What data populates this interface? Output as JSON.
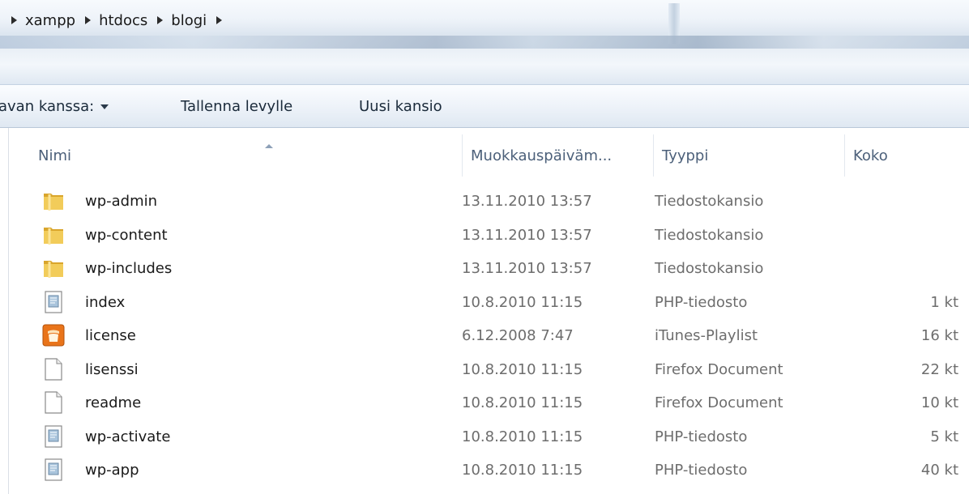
{
  "address": {
    "crumbs": [
      {
        "label": "xampp"
      },
      {
        "label": "htdocs"
      },
      {
        "label": "blogi"
      }
    ]
  },
  "commands": {
    "share_label": "avan kanssa:",
    "save_label": "Tallenna levylle",
    "newfolder_label": "Uusi kansio"
  },
  "columns": {
    "name": "Nimi",
    "date": "Muokkauspäiväm...",
    "type": "Tyyppi",
    "size": "Koko"
  },
  "files": [
    {
      "name": "wp-admin",
      "date": "13.11.2010 13:57",
      "type": "Tiedostokansio",
      "size": "",
      "icon": "folder-icon"
    },
    {
      "name": "wp-content",
      "date": "13.11.2010 13:57",
      "type": "Tiedostokansio",
      "size": "",
      "icon": "folder-icon"
    },
    {
      "name": "wp-includes",
      "date": "13.11.2010 13:57",
      "type": "Tiedostokansio",
      "size": "",
      "icon": "folder-icon"
    },
    {
      "name": "index",
      "date": "10.8.2010 11:15",
      "type": "PHP-tiedosto",
      "size": "1 kt",
      "icon": "php-file-icon"
    },
    {
      "name": "license",
      "date": "6.12.2008 7:47",
      "type": "iTunes-Playlist",
      "size": "16 kt",
      "icon": "itunes-playlist-icon"
    },
    {
      "name": "lisenssi",
      "date": "10.8.2010 11:15",
      "type": "Firefox Document",
      "size": "22 kt",
      "icon": "blank-document-icon"
    },
    {
      "name": "readme",
      "date": "10.8.2010 11:15",
      "type": "Firefox Document",
      "size": "10 kt",
      "icon": "blank-document-icon"
    },
    {
      "name": "wp-activate",
      "date": "10.8.2010 11:15",
      "type": "PHP-tiedosto",
      "size": "5 kt",
      "icon": "php-file-icon"
    },
    {
      "name": "wp-app",
      "date": "10.8.2010 11:15",
      "type": "PHP-tiedosto",
      "size": "40 kt",
      "icon": "php-file-icon"
    }
  ],
  "colors": {
    "folder": "#e8b83a",
    "itunes": "#f07a12",
    "header_text": "#4c607a",
    "meta_text": "#6d6d6d"
  }
}
